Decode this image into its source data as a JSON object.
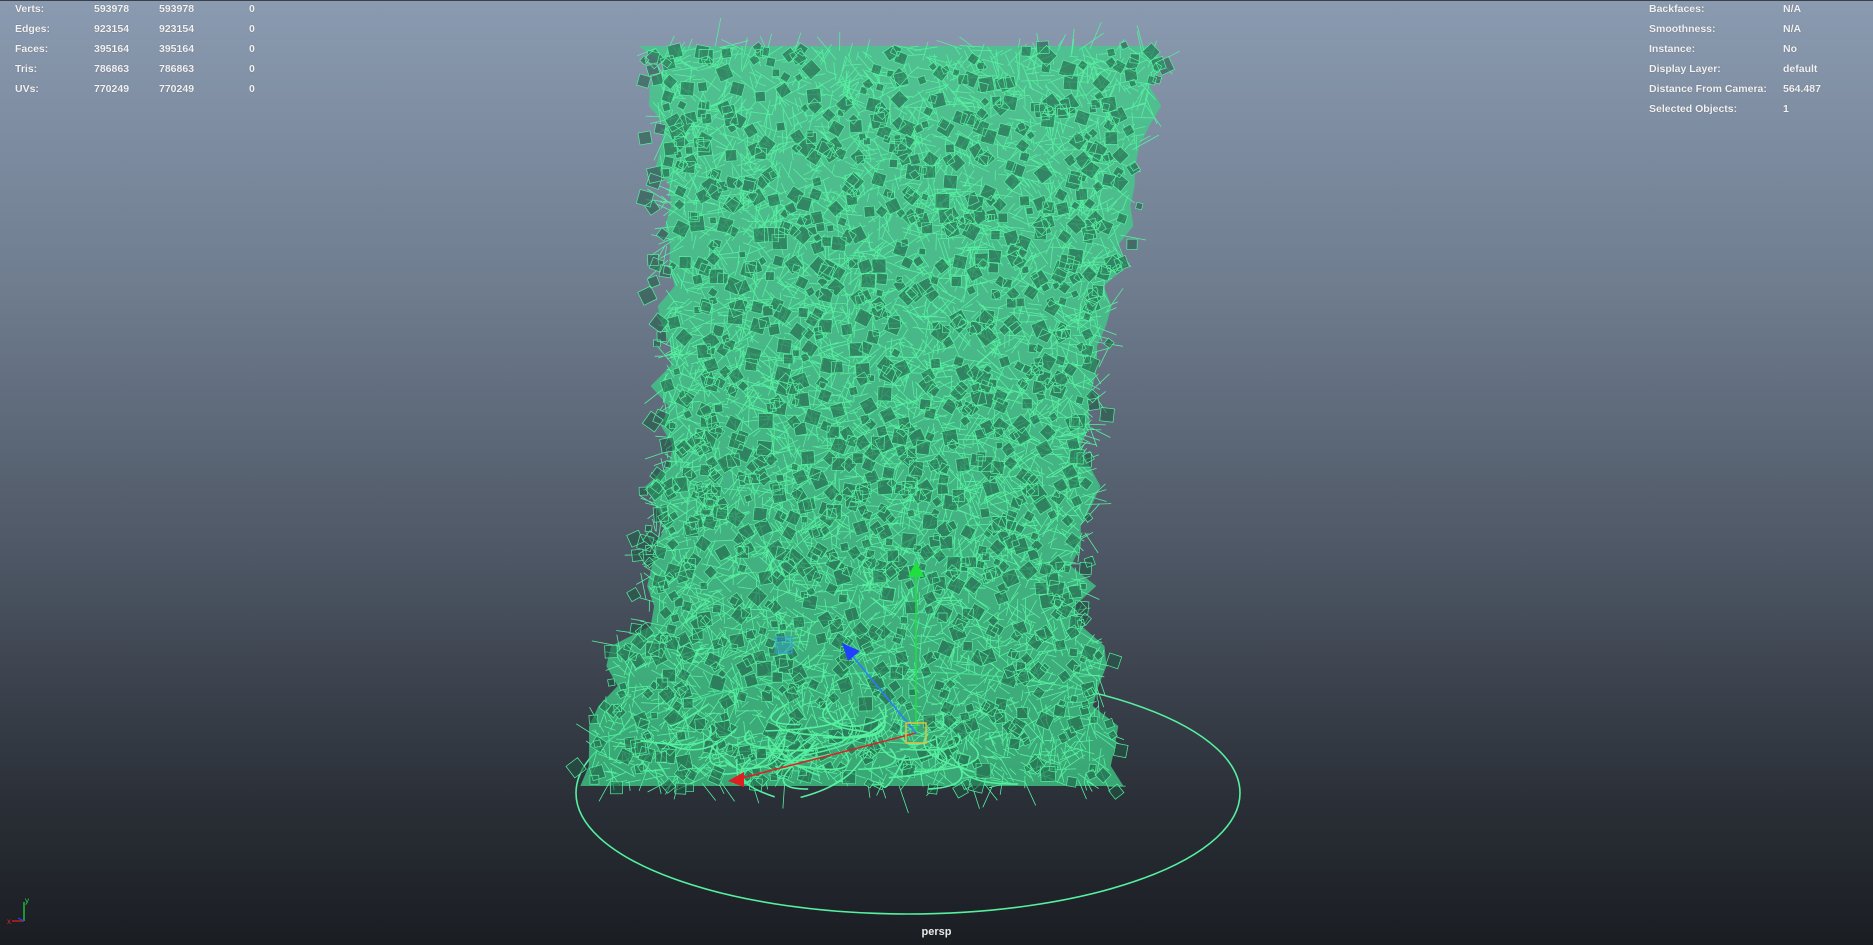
{
  "stats": {
    "rows": [
      {
        "label": "Verts:",
        "a": "593978",
        "b": "593978",
        "c": "0"
      },
      {
        "label": "Edges:",
        "a": "923154",
        "b": "923154",
        "c": "0"
      },
      {
        "label": "Faces:",
        "a": "395164",
        "b": "395164",
        "c": "0"
      },
      {
        "label": "Tris:",
        "a": "786863",
        "b": "786863",
        "c": "0"
      },
      {
        "label": "UVs:",
        "a": "770249",
        "b": "770249",
        "c": "0"
      }
    ]
  },
  "info": {
    "rows": [
      {
        "label": "Backfaces:",
        "value": "N/A"
      },
      {
        "label": "Smoothness:",
        "value": "N/A"
      },
      {
        "label": "Instance:",
        "value": "No"
      },
      {
        "label": "Display Layer:",
        "value": "default"
      },
      {
        "label": "Distance From Camera:",
        "value": "564.487"
      },
      {
        "label": "Selected Objects:",
        "value": "1"
      }
    ]
  },
  "camera": {
    "name": "persp"
  },
  "axis": {
    "x_label": "x",
    "y_label": "y"
  },
  "colors": {
    "wireframe": "#55f0a0",
    "wire_dark": "#1f5a44",
    "x_axis": "#e02020",
    "y_axis": "#20e040",
    "z_axis": "#2040ff",
    "manip_box": "#e6c040"
  }
}
